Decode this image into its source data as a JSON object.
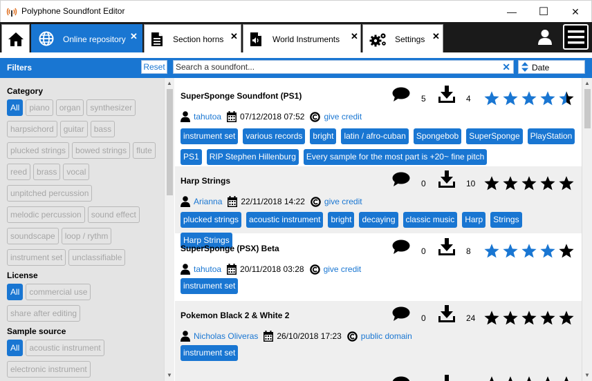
{
  "window": {
    "title": "Polyphone Soundfont Editor",
    "min_symbol": "—",
    "max_symbol": "☐",
    "close_symbol": "✕"
  },
  "tabs": [
    {
      "label": "",
      "icon": "home-icon"
    },
    {
      "label": "Online repository",
      "icon": "globe-icon",
      "active": true,
      "close": "✕"
    },
    {
      "label": "Section horns",
      "icon": "document-icon",
      "close": "✕"
    },
    {
      "label": "World Instruments",
      "icon": "speaker-file-icon",
      "close": "✕"
    },
    {
      "label": "Settings",
      "icon": "gears-icon",
      "close": "✕"
    }
  ],
  "filterbar": {
    "title": "Filters",
    "reset_label": "Reset",
    "search_placeholder": "Search a soundfont...",
    "search_clear": "✕",
    "sort_label": "Date"
  },
  "sidebar": {
    "category_title": "Category",
    "categories": [
      "All",
      "piano",
      "organ",
      "synthesizer",
      "harpsichord",
      "guitar",
      "bass",
      "plucked strings",
      "bowed strings",
      "flute",
      "reed",
      "brass",
      "vocal",
      "unpitched percussion",
      "melodic percussion",
      "sound effect",
      "soundscape",
      "loop / rythm",
      "instrument set",
      "unclassifiable"
    ],
    "license_title": "License",
    "licenses": [
      "All",
      "commercial use",
      "share after editing"
    ],
    "source_title": "Sample source",
    "sources": [
      "All",
      "acoustic instrument",
      "electronic instrument"
    ]
  },
  "items": [
    {
      "name": "SuperSponge Soundfont (PS1)",
      "comments": "5",
      "downloads": "4",
      "rating": 4.5,
      "author": "tahutoa",
      "date": "07/12/2018 07:52",
      "license": "give credit",
      "tags": [
        "instrument set",
        "various records",
        "bright",
        "latin / afro-cuban",
        "Spongebob",
        "SuperSponge",
        "PlayStation",
        "PS1",
        "RIP Stephen Hillenburg",
        "Every sample for the most part is +20~ fine pitch"
      ]
    },
    {
      "name": "Harp Strings",
      "comments": "0",
      "downloads": "10",
      "rating": 0,
      "author": "Arianna",
      "date": "22/11/2018 14:22",
      "license": "give credit",
      "tags": [
        "plucked strings",
        "acoustic instrument",
        "bright",
        "decaying",
        "classic music",
        "Harp",
        "Strings",
        "Harp Strings"
      ]
    },
    {
      "name": "SuperSponge (PSX) Beta",
      "comments": "0",
      "downloads": "8",
      "rating": 4,
      "author": "tahutoa",
      "date": "20/11/2018 03:28",
      "license": "give credit",
      "tags": [
        "instrument set"
      ]
    },
    {
      "name": "Pokemon Black 2 & White 2",
      "comments": "0",
      "downloads": "24",
      "rating": 0,
      "author": "Nicholas Oliveras",
      "date": "26/10/2018 17:23",
      "license": "public domain",
      "tags": [
        "instrument set"
      ]
    }
  ],
  "colors": {
    "accent": "#1976d2",
    "star_filled": "#1976d2",
    "star_empty": "#000000",
    "tabbar": "#1a1a1a",
    "sidebar": "#e4e4e4"
  }
}
